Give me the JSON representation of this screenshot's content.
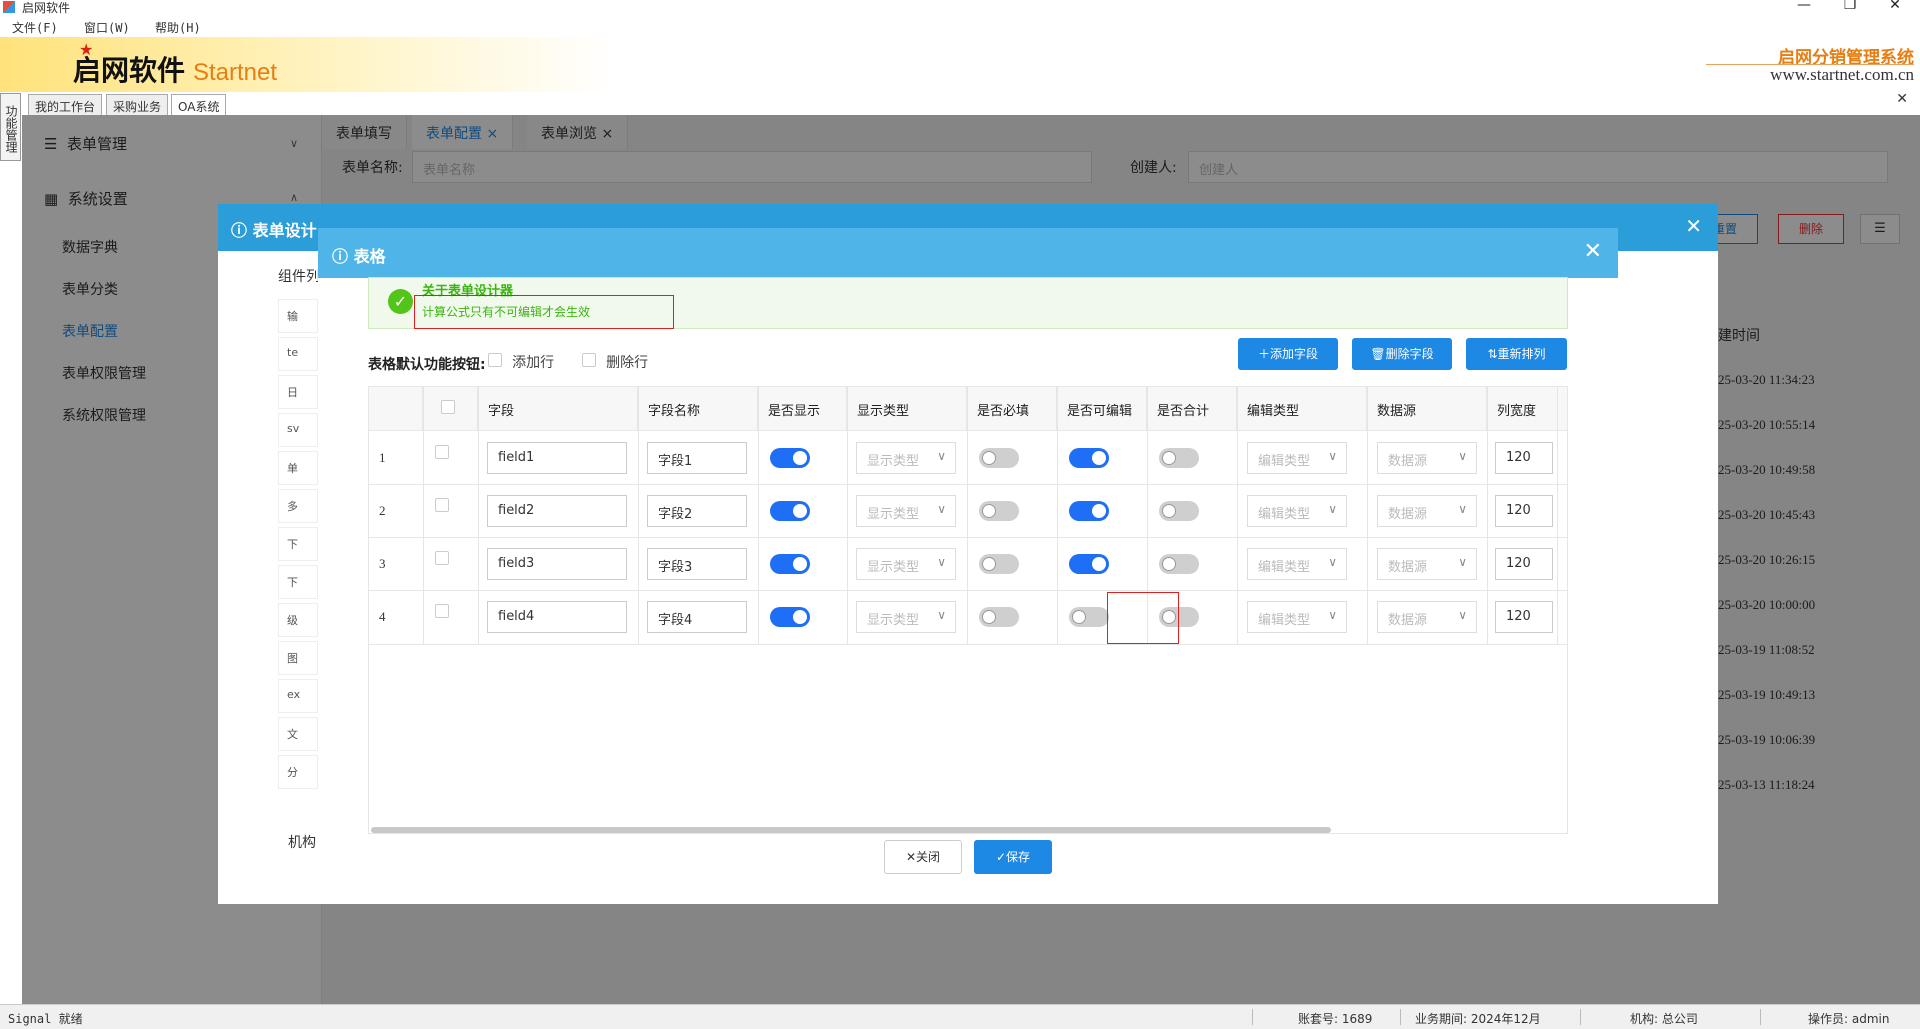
{
  "window": {
    "title": "启网软件"
  },
  "menu": [
    "文件(F)",
    "窗口(W)",
    "帮助(H)"
  ],
  "header": {
    "logo_cn": "启网软件",
    "logo_en": "Startnet",
    "brand": "启网分销管理系统",
    "site": "www.startnet.com.cn"
  },
  "main_tabs": [
    "我的工作台",
    "采购业务",
    "OA系统"
  ],
  "vertical_tab": "功能管理",
  "sidebar": {
    "groups": [
      "表单管理",
      "系统设置"
    ],
    "items": [
      "数据字典",
      "表单分类",
      "表单配置",
      "表单权限管理",
      "系统权限管理"
    ]
  },
  "content_tabs": [
    "表单填写",
    "表单配置",
    "表单浏览"
  ],
  "filters": {
    "form_name_label": "表单名称:",
    "form_name_placeholder": "表单名称",
    "creator_label": "创建人:",
    "creator_placeholder": "创建人"
  },
  "bg_actions": [
    "重置",
    "删除"
  ],
  "bg_table": {
    "header": "建时间",
    "times": [
      "25-03-20 11:34:23",
      "25-03-20 10:55:14",
      "25-03-20 10:49:58",
      "25-03-20 10:45:43",
      "25-03-20 10:26:15",
      "25-03-20 10:00:00",
      "25-03-19 11:08:52",
      "25-03-19 10:49:13",
      "25-03-19 10:06:39",
      "25-03-13 11:18:24"
    ]
  },
  "outer_modal": {
    "title": "表单设计",
    "components_label": "组件列",
    "org_label": "机构"
  },
  "left_components": [
    "输",
    "te",
    "日",
    "sv",
    "单",
    "多",
    "下",
    "下",
    "级",
    "图",
    "ex",
    "文",
    "分"
  ],
  "inner_modal": {
    "title": "表格",
    "alert_title": "关于表单设计器",
    "alert_text": "计算公式只有不可编辑才会生效",
    "func_label": "表格默认功能按钮:",
    "add_row_label": "添加行",
    "delete_row_label": "删除行",
    "btn_add_field": "添加字段",
    "btn_delete_field": "删除字段",
    "btn_reorder": "重新排列",
    "btn_close": "关闭",
    "btn_save": "保存"
  },
  "columns": [
    "字段",
    "字段名称",
    "是否显示",
    "显示类型",
    "是否必填",
    "是否可编辑",
    "是否合计",
    "编辑类型",
    "数据源",
    "列宽度"
  ],
  "rows": [
    {
      "num": "1",
      "field": "field1",
      "name": "字段1",
      "show": true,
      "display_type": "显示类型",
      "required": false,
      "editable": true,
      "sum": false,
      "edit_type": "编辑类型",
      "datasource": "数据源",
      "width": "120"
    },
    {
      "num": "2",
      "field": "field2",
      "name": "字段2",
      "show": true,
      "display_type": "显示类型",
      "required": false,
      "editable": true,
      "sum": false,
      "edit_type": "编辑类型",
      "datasource": "数据源",
      "width": "120"
    },
    {
      "num": "3",
      "field": "field3",
      "name": "字段3",
      "show": true,
      "display_type": "显示类型",
      "required": false,
      "editable": true,
      "sum": false,
      "edit_type": "编辑类型",
      "datasource": "数据源",
      "width": "120"
    },
    {
      "num": "4",
      "field": "field4",
      "name": "字段4",
      "show": true,
      "display_type": "显示类型",
      "required": false,
      "editable": false,
      "sum": false,
      "edit_type": "编辑类型",
      "datasource": "数据源",
      "width": "120"
    }
  ],
  "statusbar": {
    "left": "Signal 就绪",
    "account": "账套号: 1689",
    "period": "业务期间: 2024年12月",
    "org": "机构: 总公司",
    "operator": "操作员: admin"
  },
  "colors": {
    "primary": "#1e88e5",
    "header_blue": "#4fb4e8",
    "accent": "#e77e12",
    "success": "#52c41a"
  }
}
